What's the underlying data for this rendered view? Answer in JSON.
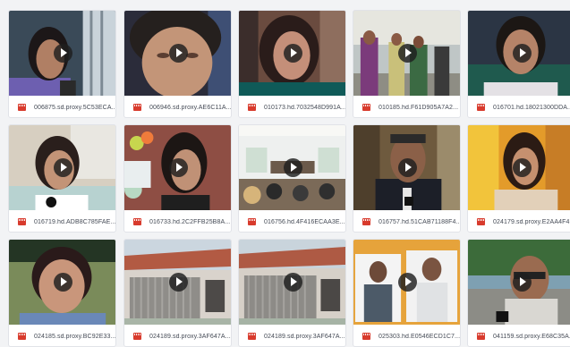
{
  "colors": {
    "background": "#f2f3f5",
    "card": "#ffffff",
    "file_icon": "#d83b2d",
    "caption_text": "#444a55",
    "play_button": "#1e1e1e"
  },
  "items": [
    {
      "filename": "006875.sd.proxy.5C53ECA...",
      "thumb": "woman-headscarf-window",
      "icon": "video-file-icon"
    },
    {
      "filename": "006946.sd.proxy.AE6C11A...",
      "thumb": "woman-closeup-sad",
      "icon": "video-file-icon"
    },
    {
      "filename": "010173.hd.7032548D991A...",
      "thumb": "woman-glasses-red",
      "icon": "video-file-icon"
    },
    {
      "filename": "010185.hd.F61D905A7A2...",
      "thumb": "men-group-street",
      "icon": "video-file-icon"
    },
    {
      "filename": "016701.hd.18021300DDA...",
      "thumb": "woman-interview-dark",
      "icon": "video-file-icon"
    },
    {
      "filename": "016719.hd.ADB8C785FAE...",
      "thumb": "woman-microphone-house",
      "icon": "video-file-icon"
    },
    {
      "filename": "016733.hd.2C2FFB25B8A...",
      "thumb": "girl-glasses-classroom",
      "icon": "video-file-icon"
    },
    {
      "filename": "016756.hd.4F416ECAA3E...",
      "thumb": "meeting-room-audience",
      "icon": "video-file-icon"
    },
    {
      "filename": "016757.hd.51CAB71188F4...",
      "thumb": "man-suit-microphone",
      "icon": "video-file-icon"
    },
    {
      "filename": "024179.sd.proxy.E2AA4F4...",
      "thumb": "woman-orange-room",
      "icon": "video-file-icon"
    },
    {
      "filename": "024185.sd.proxy.BC92E33...",
      "thumb": "woman-glasses-outdoor",
      "icon": "video-file-icon"
    },
    {
      "filename": "024189.sd.proxy.3AF647A...",
      "thumb": "house-facade-gate",
      "icon": "video-file-icon"
    },
    {
      "filename": "024189.sd.proxy.3AF647A...",
      "thumb": "house-facade-gate-2",
      "icon": "video-file-icon"
    },
    {
      "filename": "025303.hd.E0546ECD1C7...",
      "thumb": "two-men-photos",
      "icon": "video-file-icon"
    },
    {
      "filename": "041159.sd.proxy.E68C35A...",
      "thumb": "man-sunglasses-street",
      "icon": "video-file-icon"
    }
  ]
}
